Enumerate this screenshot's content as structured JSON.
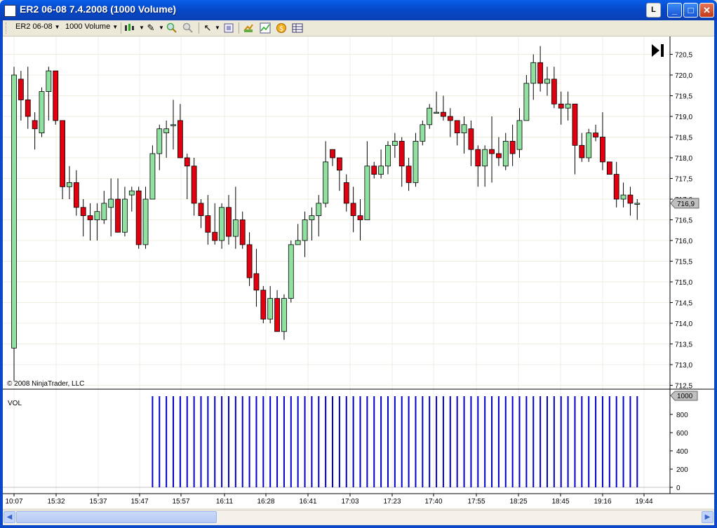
{
  "window": {
    "title": "ER2 06-08  7.4.2008 (1000 Volume)",
    "button_l": "L"
  },
  "toolbar": {
    "instrument": "ER2 06-08",
    "interval": "1000 Volume"
  },
  "icons": [
    "candlestick-icon",
    "pencil-icon",
    "zoom-in-icon",
    "zoom-out-icon",
    "pointer-icon",
    "properties-icon",
    "data-box-icon",
    "strategy-icon",
    "indicator-icon",
    "order-icon",
    "table-icon"
  ],
  "chart": {
    "copyright": "© 2008 NinjaTrader, LLC",
    "last_price_label": "716,9",
    "volume_label": "VOL",
    "volume_last_label": "1000",
    "colors": {
      "up": "#90e0a0",
      "down": "#e00010",
      "volume": "#0000c8",
      "grid": "#f0ece0"
    }
  },
  "chart_data": {
    "type": "candlestick",
    "price_axis": {
      "ticks": [
        "712,5",
        "713,0",
        "713,5",
        "714,0",
        "714,5",
        "715,0",
        "715,5",
        "716,0",
        "716,5",
        "717,0",
        "717,5",
        "718,0",
        "718,5",
        "719,0",
        "719,5",
        "720,0",
        "720,5"
      ],
      "ylim": [
        712.5,
        720.7
      ]
    },
    "time_axis": {
      "ticks": [
        "10:07",
        "15:32",
        "15:37",
        "15:47",
        "15:57",
        "16:11",
        "16:28",
        "16:41",
        "17:03",
        "17:23",
        "17:40",
        "17:55",
        "18:25",
        "18:45",
        "19:16",
        "19:44"
      ]
    },
    "volume_axis": {
      "ticks": [
        "0",
        "200",
        "400",
        "600",
        "800",
        "1000"
      ],
      "ylim": [
        0,
        1000
      ]
    },
    "candles": [
      [
        713.4,
        720.0,
        720.2,
        712.6
      ],
      [
        719.9,
        719.4,
        720.1,
        718.9
      ],
      [
        719.4,
        719.0,
        720.2,
        718.7
      ],
      [
        718.9,
        718.7,
        719.1,
        718.2
      ],
      [
        718.6,
        719.6,
        719.7,
        718.5
      ],
      [
        719.6,
        720.1,
        720.2,
        718.9
      ],
      [
        720.1,
        718.9,
        720.1,
        718.8
      ],
      [
        718.9,
        717.3,
        718.9,
        717.0
      ],
      [
        717.3,
        717.4,
        717.8,
        717.0
      ],
      [
        717.4,
        716.8,
        717.7,
        716.6
      ],
      [
        716.8,
        716.6,
        717.0,
        716.1
      ],
      [
        716.6,
        716.5,
        716.9,
        716.0
      ],
      [
        716.5,
        716.7,
        716.9,
        716.0
      ],
      [
        716.5,
        716.9,
        717.2,
        716.4
      ],
      [
        716.8,
        717.0,
        717.5,
        716.1
      ],
      [
        717.0,
        716.2,
        717.5,
        716.2
      ],
      [
        716.2,
        717.0,
        717.3,
        716.1
      ],
      [
        717.1,
        717.2,
        717.3,
        716.7
      ],
      [
        717.2,
        715.9,
        717.3,
        715.8
      ],
      [
        715.9,
        717.0,
        717.3,
        715.8
      ],
      [
        717.0,
        718.1,
        718.3,
        717.0
      ],
      [
        718.1,
        718.7,
        718.8,
        717.7
      ],
      [
        718.6,
        718.7,
        718.9,
        718.0
      ],
      [
        718.8,
        718.8,
        719.4,
        718.2
      ],
      [
        718.9,
        718.0,
        719.3,
        718.0
      ],
      [
        718.0,
        717.8,
        718.1,
        717.0
      ],
      [
        717.8,
        716.9,
        718.0,
        716.6
      ],
      [
        716.9,
        716.6,
        717.0,
        716.3
      ],
      [
        716.6,
        716.2,
        717.1,
        715.9
      ],
      [
        716.2,
        716.0,
        716.9,
        715.9
      ],
      [
        716.0,
        716.8,
        716.9,
        715.8
      ],
      [
        716.8,
        716.1,
        717.1,
        715.9
      ],
      [
        716.1,
        716.5,
        717.3,
        715.8
      ],
      [
        716.5,
        715.9,
        716.7,
        715.8
      ],
      [
        715.9,
        715.1,
        716.2,
        714.9
      ],
      [
        715.2,
        714.8,
        715.8,
        714.4
      ],
      [
        714.8,
        714.1,
        714.9,
        714.0
      ],
      [
        714.1,
        714.6,
        714.9,
        714.0
      ],
      [
        714.6,
        713.8,
        714.8,
        713.8
      ],
      [
        713.8,
        714.6,
        714.7,
        713.6
      ],
      [
        714.6,
        715.9,
        716.0,
        714.5
      ],
      [
        715.9,
        716.0,
        716.4,
        715.9
      ],
      [
        716.0,
        716.5,
        716.7,
        715.6
      ],
      [
        716.5,
        716.6,
        716.8,
        716.0
      ],
      [
        716.6,
        716.9,
        717.1,
        716.1
      ],
      [
        716.9,
        717.9,
        718.4,
        716.8
      ],
      [
        718.2,
        718.0,
        718.2,
        717.8
      ],
      [
        718.0,
        717.7,
        717.9,
        717.2
      ],
      [
        717.4,
        716.9,
        717.6,
        716.7
      ],
      [
        716.9,
        716.6,
        717.3,
        716.2
      ],
      [
        716.6,
        716.5,
        717.0,
        716.0
      ],
      [
        716.5,
        717.8,
        718.4,
        716.5
      ],
      [
        717.8,
        717.6,
        717.9,
        717.5
      ],
      [
        717.6,
        717.8,
        718.2,
        717.5
      ],
      [
        717.8,
        718.3,
        718.4,
        717.6
      ],
      [
        718.3,
        718.4,
        718.6,
        718.0
      ],
      [
        718.4,
        717.8,
        718.5,
        717.3
      ],
      [
        717.8,
        717.4,
        718.0,
        717.2
      ],
      [
        717.4,
        718.4,
        718.6,
        717.3
      ],
      [
        718.4,
        718.8,
        718.9,
        718.3
      ],
      [
        718.8,
        719.2,
        719.3,
        718.7
      ],
      [
        719.1,
        719.1,
        719.6,
        719.1
      ],
      [
        719.1,
        719.0,
        719.5,
        718.9
      ],
      [
        719.0,
        718.9,
        719.2,
        718.5
      ],
      [
        718.9,
        718.6,
        718.8,
        718.3
      ],
      [
        718.6,
        718.8,
        719.0,
        718.1
      ],
      [
        718.7,
        718.2,
        718.9,
        717.8
      ],
      [
        718.2,
        717.8,
        718.3,
        717.3
      ],
      [
        717.8,
        718.2,
        718.3,
        717.3
      ],
      [
        718.2,
        718.1,
        719.0,
        717.4
      ],
      [
        718.1,
        718.0,
        718.5,
        717.8
      ],
      [
        717.8,
        718.4,
        718.6,
        717.7
      ],
      [
        718.4,
        718.1,
        718.8,
        717.8
      ],
      [
        718.2,
        718.9,
        719.2,
        718.0
      ],
      [
        718.9,
        719.8,
        720.0,
        718.9
      ],
      [
        719.8,
        720.3,
        720.5,
        719.4
      ],
      [
        720.3,
        719.8,
        720.7,
        719.6
      ],
      [
        719.8,
        719.9,
        720.2,
        719.5
      ],
      [
        719.9,
        719.3,
        720.2,
        719.2
      ],
      [
        719.3,
        719.2,
        719.6,
        718.8
      ],
      [
        719.2,
        719.3,
        719.6,
        718.9
      ],
      [
        719.3,
        718.3,
        719.3,
        717.6
      ],
      [
        718.3,
        718.0,
        718.6,
        717.9
      ],
      [
        718.0,
        718.6,
        718.7,
        717.9
      ],
      [
        718.6,
        718.5,
        718.8,
        718.4
      ],
      [
        718.5,
        717.9,
        719.1,
        717.7
      ],
      [
        717.9,
        717.6,
        717.9,
        717.6
      ],
      [
        717.6,
        717.0,
        717.9,
        716.8
      ],
      [
        717.0,
        717.1,
        717.4,
        716.8
      ],
      [
        717.1,
        716.9,
        717.3,
        716.6
      ],
      [
        716.9,
        716.9,
        717.0,
        716.5
      ]
    ],
    "volume": {
      "per_bar": 1000,
      "first_bar_index": 20
    }
  }
}
